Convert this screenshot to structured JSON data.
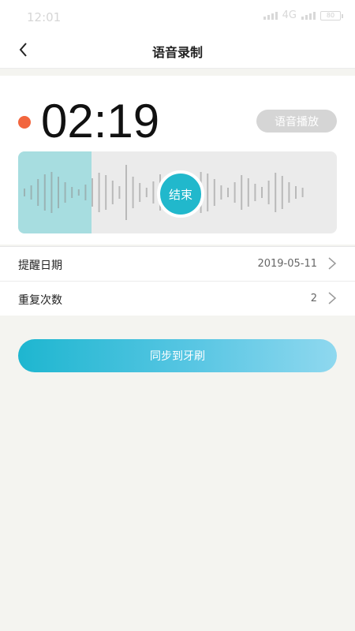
{
  "status_bar": {
    "time": "12:01",
    "network": "4G",
    "battery": "80"
  },
  "header": {
    "title": "语音录制"
  },
  "recorder": {
    "timer": "02:19",
    "play_label": "语音播放",
    "stop_label": "结束",
    "progress": 0.23,
    "colors": {
      "record_dot": "#f2663e",
      "accent": "#21b8cc",
      "progress_fill": "#a7dde0"
    }
  },
  "settings": {
    "rows": [
      {
        "label": "提醒日期",
        "value": "2019-05-11"
      },
      {
        "label": "重复次数",
        "value": "2"
      }
    ]
  },
  "actions": {
    "sync_label": "同步到牙刷"
  }
}
